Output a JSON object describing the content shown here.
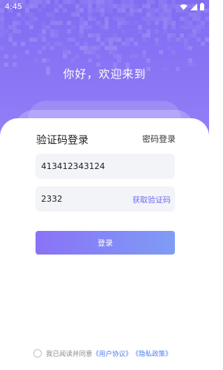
{
  "statusbar": {
    "time": "4:45"
  },
  "welcome": {
    "text": "你好，欢迎来到"
  },
  "login": {
    "title": "验证码登录",
    "switch_label": "密码登录",
    "phone_value": "413412343124",
    "code_value": "2332",
    "get_code_label": "获取验证码",
    "submit_label": "登录"
  },
  "agreement": {
    "prefix": "我已阅读并同意",
    "user_agreement": "《用户协议》",
    "privacy_policy": "《隐私政策》"
  },
  "colors": {
    "header_gradient_top": "#7f6cf2",
    "accent": "#6f6af0",
    "link": "#4c7cf0"
  },
  "icons": [
    "wifi-icon",
    "signal-icon",
    "battery-icon"
  ]
}
